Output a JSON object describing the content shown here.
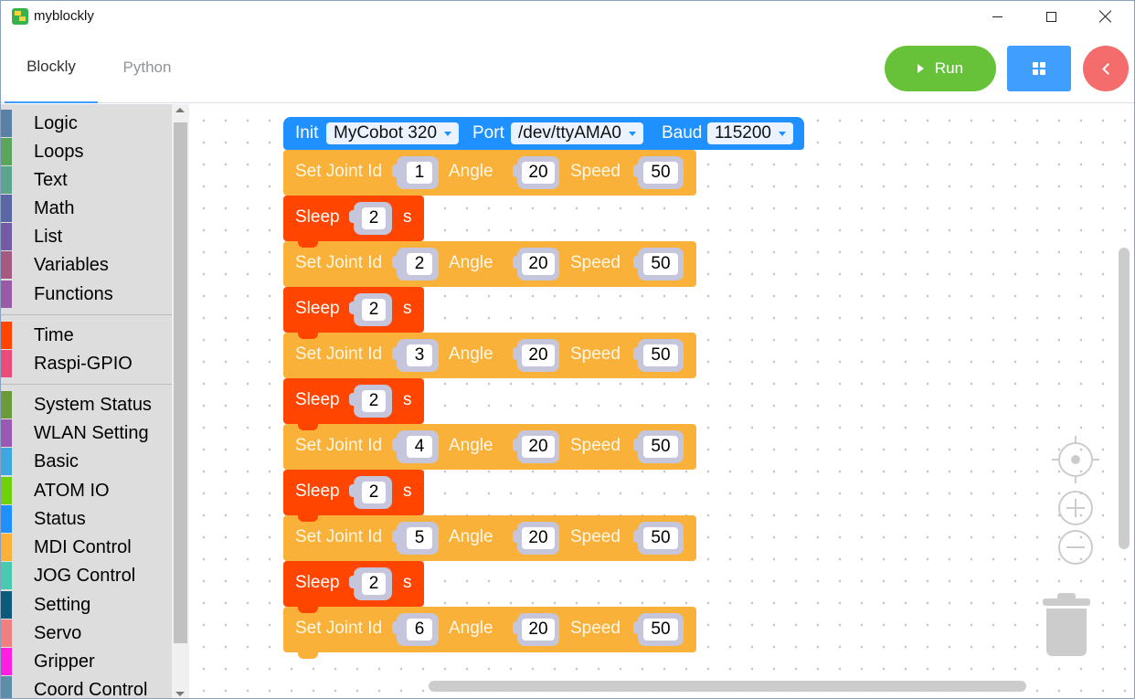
{
  "window": {
    "title": "myblockly"
  },
  "tabs": [
    {
      "label": "Blockly"
    },
    {
      "label": "Python"
    }
  ],
  "toolbar": {
    "run_label": "Run"
  },
  "toolbox": {
    "categories": [
      {
        "label": "Logic",
        "color": "#5b80a5"
      },
      {
        "label": "Loops",
        "color": "#5ba55b"
      },
      {
        "label": "Text",
        "color": "#5ba58c"
      },
      {
        "label": "Math",
        "color": "#5b67a5"
      },
      {
        "label": "List",
        "color": "#745ba5"
      },
      {
        "label": "Variables",
        "color": "#a55b80"
      },
      {
        "label": "Functions",
        "color": "#995ba5"
      },
      {
        "label": "Time",
        "color": "#ff4500"
      },
      {
        "label": "Raspi-GPIO",
        "color": "#e94b7a"
      },
      {
        "label": "System Status",
        "color": "#6a9a3a"
      },
      {
        "label": "WLAN Setting",
        "color": "#9b59b6"
      },
      {
        "label": "Basic",
        "color": "#3ea7e0"
      },
      {
        "label": "ATOM IO",
        "color": "#6fd10c"
      },
      {
        "label": "Status",
        "color": "#1e90ff"
      },
      {
        "label": "MDI Control",
        "color": "#f9b13a"
      },
      {
        "label": "JOG Control",
        "color": "#48c9b0"
      },
      {
        "label": "Setting",
        "color": "#0b5a7a"
      },
      {
        "label": "Servo",
        "color": "#f08080"
      },
      {
        "label": "Gripper",
        "color": "#ff1fe0"
      },
      {
        "label": "Coord Control",
        "color": "#5d8ea8"
      }
    ]
  },
  "workspace": {
    "init_block": {
      "init_label": "Init",
      "robot": "MyCobot 320",
      "port_label": "Port",
      "port": "/dev/ttyAMA0",
      "baud_label": "Baud",
      "baud": "115200"
    },
    "joint_label": "Set Joint Id",
    "angle_label": "Angle",
    "speed_label": "Speed",
    "sleep_label": "Sleep",
    "sleep_unit": "s",
    "joints": [
      {
        "id": "1",
        "angle": "20",
        "speed": "50"
      },
      {
        "id": "2",
        "angle": "20",
        "speed": "50"
      },
      {
        "id": "3",
        "angle": "20",
        "speed": "50"
      },
      {
        "id": "4",
        "angle": "20",
        "speed": "50"
      },
      {
        "id": "5",
        "angle": "20",
        "speed": "50"
      },
      {
        "id": "6",
        "angle": "20",
        "speed": "50"
      }
    ],
    "sleeps": [
      {
        "value": "2"
      },
      {
        "value": "2"
      },
      {
        "value": "2"
      },
      {
        "value": "2"
      },
      {
        "value": "2"
      }
    ]
  }
}
